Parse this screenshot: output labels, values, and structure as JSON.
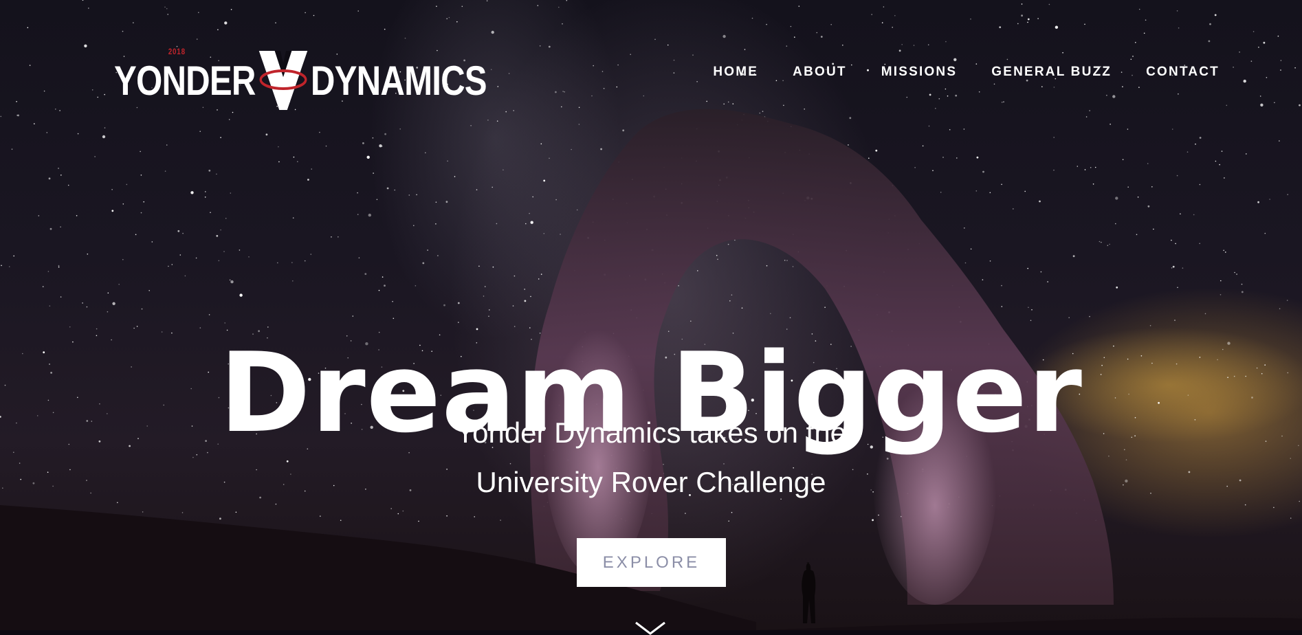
{
  "brand": {
    "left": "YONDER",
    "right": "DYNAMICS",
    "year": "2018"
  },
  "nav": {
    "items": [
      {
        "label": "HOME"
      },
      {
        "label": "ABOUT"
      },
      {
        "label": "MISSIONS"
      },
      {
        "label": "GENERAL BUZZ"
      },
      {
        "label": "CONTACT"
      }
    ]
  },
  "hero": {
    "headline": "Dream Bigger",
    "subtitle_line1": "Yonder Dynamics takes on the",
    "subtitle_line2": "University Rover Challenge",
    "cta_label": "EXPLORE"
  },
  "icons": {
    "scroll_down": "chevron-down-icon",
    "logo_mark": "yd-logo-mark-icon"
  },
  "colors": {
    "accent_red": "#c0242b",
    "cta_text": "#8b8ea7",
    "text": "#ffffff"
  }
}
